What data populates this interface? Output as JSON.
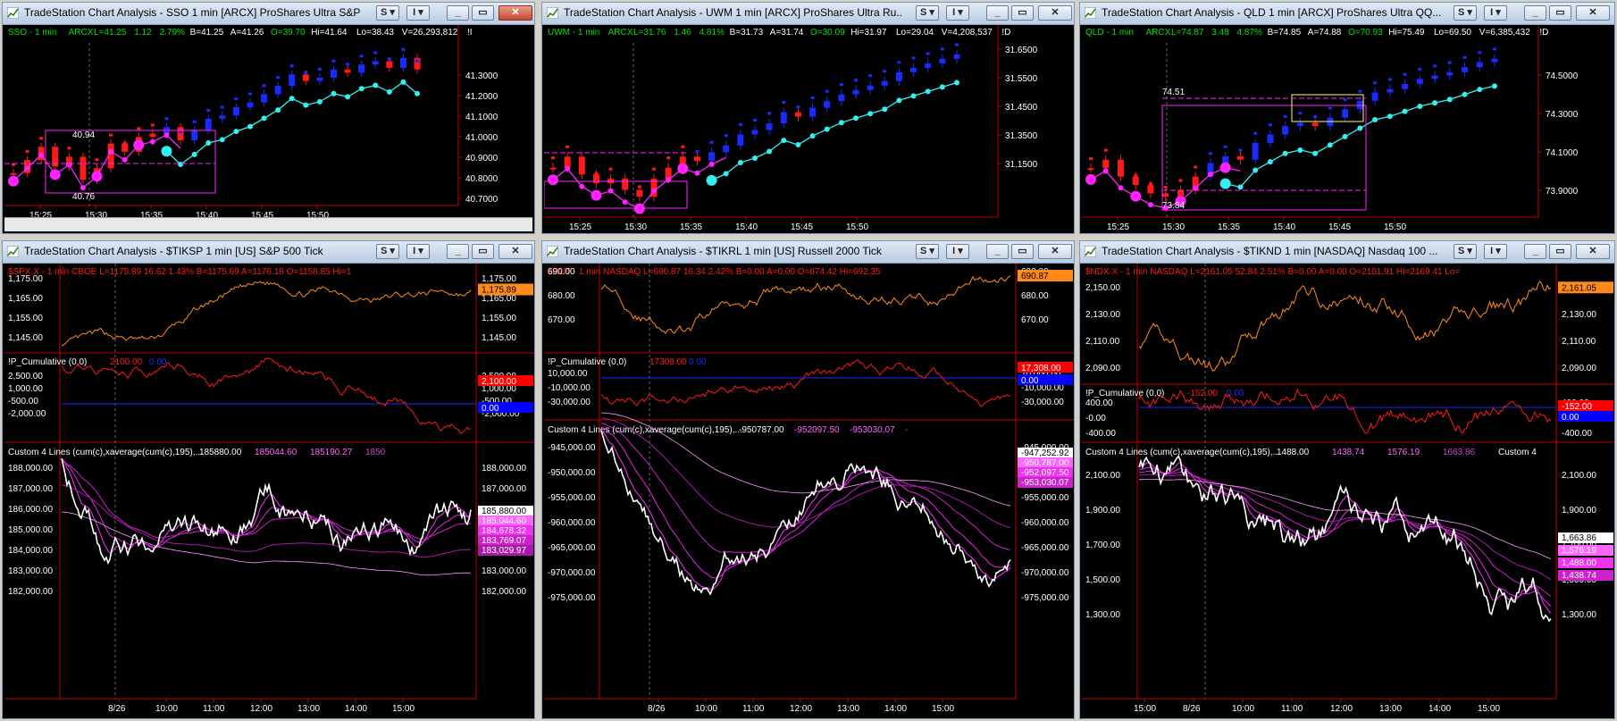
{
  "windows": [
    {
      "title": "TradeStation Chart Analysis - SSO 1 min [ARCX] ProShares Ultra S&P 5...",
      "header": {
        "symbol": "SSO - 1 min",
        "exch": "ARCX",
        "last": "L=41.25",
        "chg": "1.12",
        "pct": "2.79%",
        "bid": "B=41.25",
        "ask": "A=41.26",
        "open": "O=39.70",
        "hi": "Hi=41.64",
        "lo": "Lo=38.43",
        "vol": "V=26,293,812",
        "extra": "!I"
      },
      "price_ticks": [
        "41.3000",
        "41.2000",
        "41.1000",
        "41.0000",
        "40.9000",
        "40.8000",
        "40.7000"
      ],
      "time_ticks": [
        "15:25",
        "15:30",
        "15:35",
        "15:40",
        "15:45",
        "15:50"
      ],
      "annotations": [
        "40.94",
        "40.76"
      ],
      "chart_data": {
        "type": "candlestick",
        "series": [
          {
            "name": "SSO - 1 min",
            "values": [
              40.62,
              40.7,
              40.78,
              40.66,
              40.72,
              40.58,
              40.65,
              40.8,
              40.75,
              40.84,
              40.86,
              40.9,
              40.82,
              40.88,
              40.95,
              40.97,
              41.02,
              41.05,
              41.1,
              41.15,
              41.22,
              41.18,
              41.2,
              41.25,
              41.23,
              41.28,
              41.3,
              41.26,
              41.32,
              41.25
            ]
          }
        ]
      }
    },
    {
      "title": "TradeStation Chart Analysis - UWM 1 min [ARCX] ProShares Ultra Ru...",
      "header": {
        "symbol": "UWM - 1 min",
        "exch": "ARCX",
        "last": "L=31.76",
        "chg": "1.46",
        "pct": "4.81%",
        "bid": "B=31.73",
        "ask": "A=31.74",
        "open": "O=30.09",
        "hi": "Hi=31.97",
        "lo": "Lo=29.04",
        "vol": "V=4,208,537",
        "extra": "!D"
      },
      "price_ticks": [
        "31.6500",
        "31.5500",
        "31.4500",
        "31.3500",
        "31.1500"
      ],
      "time_ticks": [
        "15:25",
        "15:30",
        "15:35",
        "15:40",
        "15:45",
        "15:50"
      ],
      "annotations": [],
      "chart_data": {
        "type": "candlestick",
        "series": [
          {
            "name": "UWM - 1 min",
            "values": [
              31.25,
              31.3,
              31.22,
              31.18,
              31.2,
              31.15,
              31.12,
              31.2,
              31.25,
              31.3,
              31.28,
              31.32,
              31.35,
              31.4,
              31.42,
              31.45,
              31.5,
              31.48,
              31.52,
              31.55,
              31.58,
              31.6,
              31.62,
              31.64,
              31.68,
              31.7,
              31.72,
              31.74,
              31.76
            ]
          }
        ]
      }
    },
    {
      "title": "TradeStation Chart Analysis - QLD 1 min [ARCX] ProShares Ultra QQ...",
      "header": {
        "symbol": "QLD - 1 min",
        "exch": "ARCX",
        "last": "L=74.87",
        "chg": "3.48",
        "pct": "4.87%",
        "bid": "B=74.85",
        "ask": "A=74.88",
        "open": "O=70.93",
        "hi": "Hi=75.49",
        "lo": "Lo=69.50",
        "vol": "V=6,385,432",
        "extra": "!D"
      },
      "price_ticks": [
        "74.5000",
        "74.3000",
        "74.1000",
        "73.9000"
      ],
      "time_ticks": [
        "15:25",
        "15:30",
        "15:35",
        "15:40",
        "15:45",
        "15:50"
      ],
      "annotations": [
        "74.51",
        "73.84"
      ],
      "chart_data": {
        "type": "candlestick",
        "series": [
          {
            "name": "QLD - 1 min",
            "values": [
              74.05,
              74.1,
              74.0,
              73.95,
              73.9,
              73.88,
              73.92,
              74.0,
              74.08,
              74.12,
              74.1,
              74.2,
              74.25,
              74.3,
              74.32,
              74.3,
              74.35,
              74.4,
              74.45,
              74.5,
              74.52,
              74.55,
              74.58,
              74.6,
              74.62,
              74.65,
              74.68,
              74.7
            ]
          }
        ]
      }
    },
    {
      "title": "TradeStation Chart Analysis - $TIKSP 1 min [US] S&P 500 Tick",
      "p1": {
        "label": "$SPX.X - 1 min  CBOE  L=1175.89  16.62  1.43%   B=1175.69  A=1176.18  O=1158.85  Hi=1",
        "ticks": [
          "1,175.00",
          "1,165.00",
          "1,155.00",
          "1,145.00"
        ],
        "badge": "1,175.89"
      },
      "p2": {
        "label": "!P_Cumulative (0,0)",
        "v1": "2100.00",
        "v2": "0.00",
        "ticks": [
          "2,500.00",
          "1,000.00",
          "-500.00",
          "-2,000.00"
        ],
        "badge1": "2,100.00",
        "badge2": "0.00"
      },
      "p3": {
        "label": "Custom 4 Lines (cum(c),xaverage(cum(c),195),...",
        "v1": "185880.00",
        "v2": "185044.60",
        "v3": "185190.27",
        "v4": "1850",
        "ticks": [
          "188,000.00",
          "187,000.00",
          "186,000.00",
          "185,000.00",
          "184,000.00",
          "183,000.00",
          "182,000.00"
        ],
        "badges": [
          "185,880.00",
          "185,044.60",
          "184,678.32",
          "183,769.07",
          "183,029.97"
        ]
      },
      "time_ticks": [
        "8/26",
        "10:00",
        "11:00",
        "12:00",
        "13:00",
        "14:00",
        "15:00"
      ]
    },
    {
      "title": "TradeStation Chart Analysis - $TIKRL 1 min [US] Russell 2000 Tick",
      "p1": {
        "label": "$RUT - 1 min  NASDAQ  L=690.87  16.34  2.42%   B=0.00  A=0.00  O=674.42  Hi=692.35",
        "ticks": [
          "690.00",
          "680.00",
          "670.00"
        ],
        "badge": "690.87"
      },
      "p2": {
        "label": "!P_Cumulative (0,0)",
        "v1": "17308.00",
        "v2": "0.00",
        "ticks": [
          "10,000.00",
          "-10,000.00",
          "-30,000.00"
        ],
        "badge1": "17,308.00",
        "badge2": "0.00"
      },
      "p3": {
        "label": "Custom 4 Lines (cum(c),xaverage(cum(c),195),...",
        "v1": "-950787.00",
        "v2": "-952097.50",
        "v3": "-953030.07",
        "v4": "-",
        "ticks": [
          "-945,000.00",
          "-950,000.00",
          "-955,000.00",
          "-960,000.00",
          "-965,000.00",
          "-970,000.00",
          "-975,000.00"
        ],
        "badges": [
          "-947,252.92",
          "-950,787.00",
          "-952,097.50",
          "-953,030.07"
        ]
      },
      "time_ticks": [
        "8/26",
        "10:00",
        "11:00",
        "12:00",
        "13:00",
        "14:00",
        "15:00"
      ]
    },
    {
      "title": "TradeStation Chart Analysis - $TIKND 1 min [NASDAQ] Nasdaq 100 ...",
      "p1": {
        "label": "$NDX.X - 1 min  NASDAQ  L=2161.05  52.84  2.51%   B=0.00  A=0.00  O=2101.91  Hi=2169.41  Lo=",
        "ticks": [
          "2,150.00",
          "2,130.00",
          "2,110.00",
          "2,090.00"
        ],
        "badge": "2,161.05"
      },
      "p2": {
        "label": "!P_Cumulative (0,0)",
        "v1": "-152.00",
        "v2": "0.00",
        "ticks": [
          "400.00",
          "-0.00",
          "-400.00"
        ],
        "badge1": "-152.00",
        "badge2": "0.00"
      },
      "p3": {
        "label": "Custom 4 Lines (cum(c),xaverage(cum(c),195),...",
        "v1": "1488.00",
        "v2": "1438.74",
        "v3": "1576.19",
        "v4": "1663.86",
        "extra": "Custom 4",
        "ticks": [
          "2,100.00",
          "1,900.00",
          "1,700.00",
          "1,500.00",
          "1,300.00"
        ],
        "badges": [
          "1,663.86",
          "1,576.19",
          "1,488.00",
          "1,438.74"
        ]
      },
      "time_ticks": [
        "15:00",
        "8/26",
        "10:00",
        "11:00",
        "12:00",
        "13:00",
        "14:00",
        "15:00"
      ]
    }
  ],
  "buttons": {
    "s": "S",
    "i": "I"
  },
  "colors": {
    "up": "#1a2bff",
    "down": "#ff1a1a",
    "cyan": "#33f0f0",
    "magenta": "#ff22ff",
    "orange": "#ff8a1a",
    "axisRed": "#c00000",
    "green": "#00e000",
    "white": "#ffffff"
  }
}
